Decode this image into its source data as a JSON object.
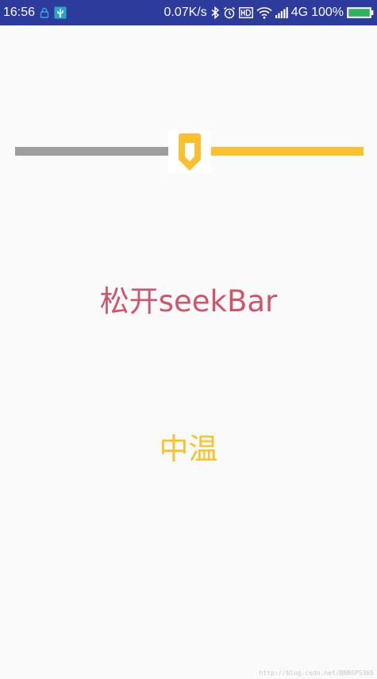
{
  "status_bar": {
    "time": "16:56",
    "net_speed": "0.07K/s",
    "network_type": "4G",
    "battery": "100%",
    "background": "#2d3c9c",
    "left_icons": [
      "lock-icon",
      "usb-icon"
    ],
    "right_icons": [
      "bluetooth-icon",
      "alarm-icon",
      "hd-icon",
      "wifi-icon",
      "signal-icon",
      "battery-icon"
    ]
  },
  "seekbar": {
    "progress": 0.5,
    "progress_color": "#9e9e9e",
    "remaining_color": "#fbc02d",
    "thumb_color": "#fbc02d"
  },
  "main": {
    "release_label": "松开seekBar",
    "release_color": "#d1546a",
    "temperature_label": "中温",
    "temperature_color": "#f9c12a"
  },
  "watermark": "http://blog.csdn.net/BNBSPS365"
}
